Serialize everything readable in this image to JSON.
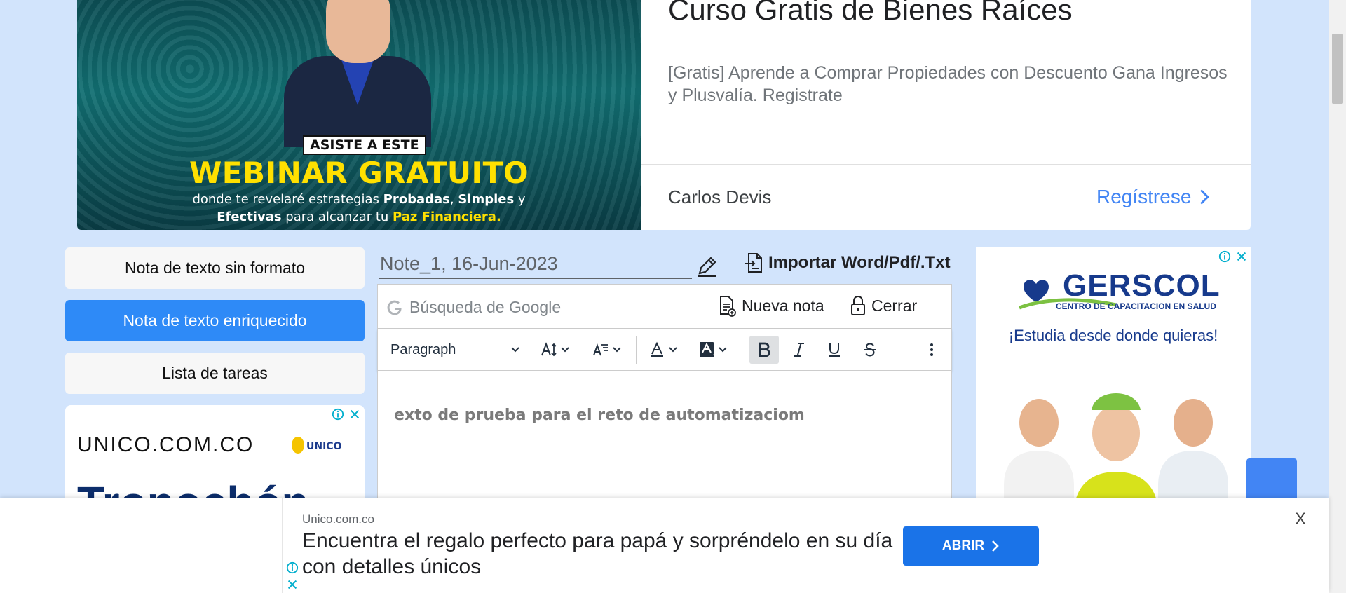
{
  "top_ad": {
    "badge": "ASISTE A ESTE",
    "headline": "WEBINAR GRATUITO",
    "sub_line1_a": "donde te revelaré estrategias ",
    "sub_line1_b": "Probadas",
    "sub_line1_c": ", ",
    "sub_line1_d": "Simples",
    "sub_line1_e": " y",
    "sub_line2_a": "Efectivas",
    "sub_line2_b": " para alcanzar tu ",
    "sub_line2_c": "Paz Financiera.",
    "title": "Curso Gratis de Bienes Raíces",
    "description": "[Gratis] Aprende a Comprar Propiedades con Descuento Gana Ingresos y Plusvalía. Registrate",
    "advertiser": "Carlos Devis",
    "cta": "Regístrese"
  },
  "sidebar": {
    "items": [
      {
        "label": "Nota de texto sin formato"
      },
      {
        "label": "Nota de texto enriquecido"
      },
      {
        "label": "Lista de tareas"
      }
    ]
  },
  "side_ad": {
    "brand": "UNICO.COM.CO",
    "logo_text": "UNICO",
    "big_text": "Tronochón"
  },
  "note": {
    "title": "Note_1, 16-Jun-2023",
    "import_label": "Importar Word/Pdf/.Txt",
    "search_placeholder": "Búsqueda de Google",
    "new_note_label": "Nueva nota",
    "close_label": "Cerrar",
    "block_format": "Paragraph",
    "content": "exto de prueba para el reto de automatizaciom"
  },
  "right_ad": {
    "brand": "GERSCOL",
    "subtitle": "CENTRO DE CAPACITACION EN SALUD",
    "slogan": "¡Estudia desde donde quieras!"
  },
  "bottom_ad": {
    "domain": "Unico.com.co",
    "headline": "Encuentra el regalo perfecto para papá y sorpréndelo en su día con detalles únicos",
    "cta": "ABRIR",
    "close": "X"
  },
  "colors": {
    "page_bg": "#d2e4fc",
    "accent_blue": "#2e8af7",
    "link_blue": "#4285f4",
    "ad_yellow": "#ffe000"
  }
}
